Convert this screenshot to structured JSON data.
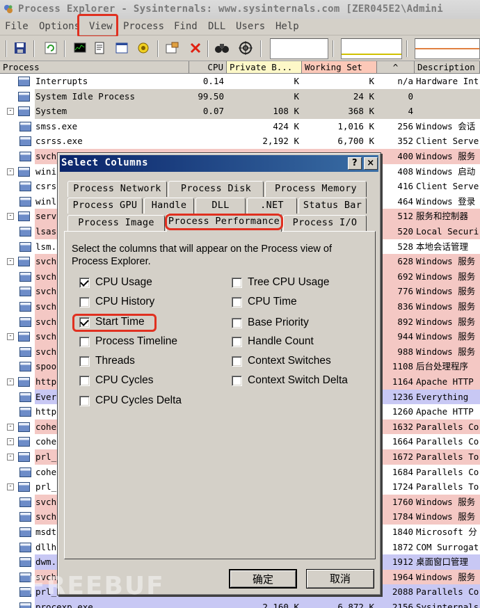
{
  "window": {
    "title": "Process Explorer - Sysinternals: www.sysinternals.com [ZER045E2\\Admini"
  },
  "menu": [
    "File",
    "Options",
    "View",
    "Process",
    "Find",
    "DLL",
    "Users",
    "Help"
  ],
  "columns": {
    "process": "Process",
    "cpu": "CPU",
    "private_bytes": "Private B...",
    "working_set": "Working Set",
    "pid": "^",
    "description": "Description"
  },
  "rows": [
    {
      "name": "Interrupts",
      "cpu": "0.14",
      "priv": "K",
      "ws": "K",
      "pid": "n/a",
      "desc": "Hardware Int",
      "bg": "#ffffff",
      "expander": "",
      "indent": 0
    },
    {
      "name": "System Idle Process",
      "cpu": "99.50",
      "priv": "K",
      "ws": "24 K",
      "pid": "0",
      "desc": "",
      "bg": "#d4d0c8",
      "expander": "",
      "indent": 0
    },
    {
      "name": "System",
      "cpu": "0.07",
      "priv": "108 K",
      "ws": "368 K",
      "pid": "4",
      "desc": "",
      "bg": "#d4d0c8",
      "expander": "-",
      "indent": 0
    },
    {
      "name": "smss.exe",
      "cpu": "",
      "priv": "424 K",
      "ws": "1,016 K",
      "pid": "256",
      "desc": "Windows 会话",
      "bg": "#ffffff",
      "expander": "",
      "indent": 1
    },
    {
      "name": "csrss.exe",
      "cpu": "",
      "priv": "2,192 K",
      "ws": "6,700 K",
      "pid": "352",
      "desc": "Client Serve",
      "bg": "#ffffff",
      "expander": "",
      "indent": 1
    },
    {
      "name": "svch",
      "cpu": "",
      "priv": "",
      "ws": "",
      "pid": "400",
      "desc": "Windows 服务",
      "bg": "#f4c8c4",
      "expander": "",
      "indent": 1
    },
    {
      "name": "wini",
      "cpu": "",
      "priv": "",
      "ws": "",
      "pid": "408",
      "desc": "Windows 启动",
      "bg": "#ffffff",
      "expander": "-",
      "indent": 0
    },
    {
      "name": "csrs",
      "cpu": "",
      "priv": "",
      "ws": "",
      "pid": "416",
      "desc": "Client Serve",
      "bg": "#ffffff",
      "expander": "",
      "indent": 1
    },
    {
      "name": "winl",
      "cpu": "",
      "priv": "",
      "ws": "",
      "pid": "464",
      "desc": "Windows 登录",
      "bg": "#ffffff",
      "expander": "",
      "indent": 1
    },
    {
      "name": "serv",
      "cpu": "",
      "priv": "",
      "ws": "",
      "pid": "512",
      "desc": "服务和控制器",
      "bg": "#f4c8c4",
      "expander": "-",
      "indent": 0
    },
    {
      "name": "lsas",
      "cpu": "",
      "priv": "",
      "ws": "",
      "pid": "520",
      "desc": "Local Securi",
      "bg": "#f4c8c4",
      "expander": "",
      "indent": 1
    },
    {
      "name": "lsm.",
      "cpu": "",
      "priv": "",
      "ws": "",
      "pid": "528",
      "desc": "本地会话管理",
      "bg": "#ffffff",
      "expander": "",
      "indent": 1
    },
    {
      "name": "svch",
      "cpu": "",
      "priv": "",
      "ws": "",
      "pid": "628",
      "desc": "Windows 服务",
      "bg": "#f4c8c4",
      "expander": "-",
      "indent": 0
    },
    {
      "name": "svch",
      "cpu": "",
      "priv": "",
      "ws": "",
      "pid": "692",
      "desc": "Windows 服务",
      "bg": "#f4c8c4",
      "expander": "",
      "indent": 1
    },
    {
      "name": "svch",
      "cpu": "",
      "priv": "",
      "ws": "",
      "pid": "776",
      "desc": "Windows 服务",
      "bg": "#f4c8c4",
      "expander": "",
      "indent": 1
    },
    {
      "name": "svch",
      "cpu": "",
      "priv": "",
      "ws": "",
      "pid": "836",
      "desc": "Windows 服务",
      "bg": "#f4c8c4",
      "expander": "",
      "indent": 1
    },
    {
      "name": "svch",
      "cpu": "",
      "priv": "",
      "ws": "",
      "pid": "892",
      "desc": "Windows 服务",
      "bg": "#f4c8c4",
      "expander": "",
      "indent": 1
    },
    {
      "name": "svch",
      "cpu": "",
      "priv": "",
      "ws": "",
      "pid": "944",
      "desc": "Windows 服务",
      "bg": "#f4c8c4",
      "expander": "-",
      "indent": 0
    },
    {
      "name": "svch",
      "cpu": "",
      "priv": "",
      "ws": "",
      "pid": "988",
      "desc": "Windows 服务",
      "bg": "#f4c8c4",
      "expander": "",
      "indent": 1
    },
    {
      "name": "spoo",
      "cpu": "",
      "priv": "",
      "ws": "",
      "pid": "1108",
      "desc": "后台处理程序",
      "bg": "#f4c8c4",
      "expander": "",
      "indent": 1
    },
    {
      "name": "http",
      "cpu": "",
      "priv": "",
      "ws": "",
      "pid": "1164",
      "desc": "Apache HTTP",
      "bg": "#f4c8c4",
      "expander": "-",
      "indent": 0
    },
    {
      "name": "Ever",
      "cpu": "",
      "priv": "",
      "ws": "",
      "pid": "1236",
      "desc": "Everything",
      "bg": "#c8c8f4",
      "expander": "",
      "indent": 1
    },
    {
      "name": "http",
      "cpu": "",
      "priv": "",
      "ws": "",
      "pid": "1260",
      "desc": "Apache HTTP",
      "bg": "#ffffff",
      "expander": "",
      "indent": 1
    },
    {
      "name": "cohe",
      "cpu": "",
      "priv": "",
      "ws": "",
      "pid": "1632",
      "desc": "Parallels Co",
      "bg": "#f4c8c4",
      "expander": "-",
      "indent": 0
    },
    {
      "name": "cohe",
      "cpu": "",
      "priv": "",
      "ws": "",
      "pid": "1664",
      "desc": "Parallels Co",
      "bg": "#ffffff",
      "expander": "-",
      "indent": 0
    },
    {
      "name": "prl_",
      "cpu": "",
      "priv": "",
      "ws": "",
      "pid": "1672",
      "desc": "Parallels To",
      "bg": "#f4c8c4",
      "expander": "-",
      "indent": 0
    },
    {
      "name": "cohe",
      "cpu": "",
      "priv": "",
      "ws": "",
      "pid": "1684",
      "desc": "Parallels Co",
      "bg": "#ffffff",
      "expander": "",
      "indent": 1
    },
    {
      "name": "prl_",
      "cpu": "",
      "priv": "",
      "ws": "",
      "pid": "1724",
      "desc": "Parallels To",
      "bg": "#ffffff",
      "expander": "-",
      "indent": 0
    },
    {
      "name": "svch",
      "cpu": "",
      "priv": "",
      "ws": "",
      "pid": "1760",
      "desc": "Windows 服务",
      "bg": "#f4c8c4",
      "expander": "",
      "indent": 1
    },
    {
      "name": "svch",
      "cpu": "",
      "priv": "",
      "ws": "",
      "pid": "1784",
      "desc": "Windows 服务",
      "bg": "#f4c8c4",
      "expander": "",
      "indent": 1
    },
    {
      "name": "msdt",
      "cpu": "",
      "priv": "",
      "ws": "",
      "pid": "1840",
      "desc": "Microsoft 分",
      "bg": "#ffffff",
      "expander": "",
      "indent": 1
    },
    {
      "name": "dllh",
      "cpu": "",
      "priv": "",
      "ws": "",
      "pid": "1872",
      "desc": "COM Surrogat",
      "bg": "#ffffff",
      "expander": "",
      "indent": 1
    },
    {
      "name": "dwm.",
      "cpu": "",
      "priv": "",
      "ws": "",
      "pid": "1912",
      "desc": "桌面窗口管理",
      "bg": "#c8c8f4",
      "expander": "",
      "indent": 1
    },
    {
      "name": "svch",
      "cpu": "",
      "priv": "",
      "ws": "",
      "pid": "1964",
      "desc": "Windows 服务",
      "bg": "#f4c8c4",
      "expander": "",
      "indent": 1
    },
    {
      "name": "prl_",
      "cpu": "",
      "priv": "",
      "ws": "",
      "pid": "2088",
      "desc": "Parallels Co",
      "bg": "#c8c8f4",
      "expander": "",
      "indent": 1
    },
    {
      "name": "procexp.exe",
      "cpu": "",
      "priv": "2,160 K",
      "ws": "6,872 K",
      "pid": "2156",
      "desc": "Sysinternals",
      "bg": "#c8c8f4",
      "expander": "",
      "indent": 1
    }
  ],
  "dialog": {
    "title": "Select Columns",
    "help_label": "?",
    "close_label": "×",
    "tabs_row1": [
      "Process Network",
      "Process Disk",
      "Process Memory"
    ],
    "tabs_row2": [
      "Process GPU",
      "Handle",
      "DLL",
      ".NET",
      "Status Bar"
    ],
    "tabs_row3": [
      "Process Image",
      "Process Performance",
      "Process I/O"
    ],
    "instruction": "Select the columns that will appear on the Process view of Process Explorer.",
    "left_options": [
      {
        "label": "CPU Usage",
        "checked": true
      },
      {
        "label": "CPU History",
        "checked": false
      },
      {
        "label": "Start Time",
        "checked": true
      },
      {
        "label": "Process Timeline",
        "checked": false
      },
      {
        "label": "Threads",
        "checked": false
      },
      {
        "label": "CPU Cycles",
        "checked": false
      },
      {
        "label": "CPU Cycles Delta",
        "checked": false
      }
    ],
    "right_options": [
      {
        "label": "Tree CPU Usage",
        "checked": false
      },
      {
        "label": "CPU Time",
        "checked": false
      },
      {
        "label": "Base Priority",
        "checked": false
      },
      {
        "label": "Handle Count",
        "checked": false
      },
      {
        "label": "Context Switches",
        "checked": false
      },
      {
        "label": "Context Switch Delta",
        "checked": false
      }
    ],
    "ok_label": "确定",
    "cancel_label": "取消"
  },
  "watermark": "FREEBUF",
  "colors": {
    "service_row": "#f4c8c4",
    "own_process_row": "#c8c8f4",
    "highlight": "#e03020",
    "dialog_title": "#0a246a"
  }
}
